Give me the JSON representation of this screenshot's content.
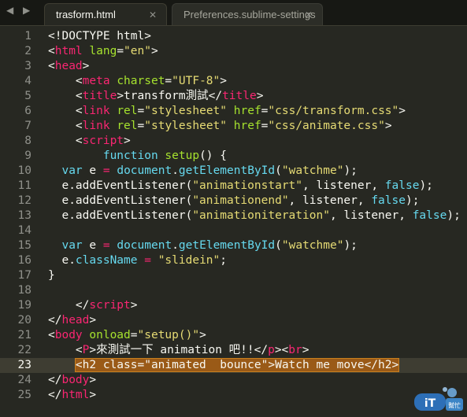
{
  "tabs": [
    {
      "label": "trasform.html",
      "active": true
    },
    {
      "label": "Preferences.sublime-settings",
      "active": false
    }
  ],
  "current_line": 23,
  "lines": [
    {
      "n": "1",
      "code": [
        [
          "p",
          "<!DOCTYPE html>"
        ]
      ]
    },
    {
      "n": "2",
      "code": [
        [
          "p",
          "<"
        ],
        [
          "t",
          "html"
        ],
        [
          "p",
          " "
        ],
        [
          "a",
          "lang"
        ],
        [
          "p",
          "="
        ],
        [
          "s",
          "\"en\""
        ],
        [
          "p",
          ">"
        ]
      ]
    },
    {
      "n": "3",
      "code": [
        [
          "p",
          "<"
        ],
        [
          "t",
          "head"
        ],
        [
          "p",
          ">"
        ]
      ]
    },
    {
      "n": "4",
      "code": [
        [
          "p",
          "    <"
        ],
        [
          "t",
          "meta"
        ],
        [
          "p",
          " "
        ],
        [
          "a",
          "charset"
        ],
        [
          "p",
          "="
        ],
        [
          "s",
          "\"UTF-8\""
        ],
        [
          "p",
          ">"
        ]
      ]
    },
    {
      "n": "5",
      "code": [
        [
          "p",
          "    <"
        ],
        [
          "t",
          "title"
        ],
        [
          "p",
          ">transform測試</"
        ],
        [
          "t",
          "title"
        ],
        [
          "p",
          ">"
        ]
      ]
    },
    {
      "n": "6",
      "code": [
        [
          "p",
          "    <"
        ],
        [
          "t",
          "link"
        ],
        [
          "p",
          " "
        ],
        [
          "a",
          "rel"
        ],
        [
          "p",
          "="
        ],
        [
          "s",
          "\"stylesheet\""
        ],
        [
          "p",
          " "
        ],
        [
          "a",
          "href"
        ],
        [
          "p",
          "="
        ],
        [
          "s",
          "\"css/transform.css\""
        ],
        [
          "p",
          ">"
        ]
      ]
    },
    {
      "n": "7",
      "code": [
        [
          "p",
          "    <"
        ],
        [
          "t",
          "link"
        ],
        [
          "p",
          " "
        ],
        [
          "a",
          "rel"
        ],
        [
          "p",
          "="
        ],
        [
          "s",
          "\"stylesheet\""
        ],
        [
          "p",
          " "
        ],
        [
          "a",
          "href"
        ],
        [
          "p",
          "="
        ],
        [
          "s",
          "\"css/animate.css\""
        ],
        [
          "p",
          ">"
        ]
      ]
    },
    {
      "n": "8",
      "code": [
        [
          "p",
          "    <"
        ],
        [
          "t",
          "script"
        ],
        [
          "p",
          ">"
        ]
      ]
    },
    {
      "n": "9",
      "code": [
        [
          "p",
          "        "
        ],
        [
          "k",
          "function"
        ],
        [
          "p",
          " "
        ],
        [
          "a",
          "setup"
        ],
        [
          "p",
          "() {"
        ]
      ]
    },
    {
      "n": "10",
      "code": [
        [
          "p",
          "  "
        ],
        [
          "k",
          "var"
        ],
        [
          "p",
          " e "
        ],
        [
          "o",
          "="
        ],
        [
          "p",
          " "
        ],
        [
          "k",
          "document"
        ],
        [
          "p",
          "."
        ],
        [
          "k",
          "getElementById"
        ],
        [
          "p",
          "("
        ],
        [
          "s",
          "\"watchme\""
        ],
        [
          "p",
          ");"
        ]
      ]
    },
    {
      "n": "11",
      "code": [
        [
          "p",
          "  e.addEventListener("
        ],
        [
          "s",
          "\"animationstart\""
        ],
        [
          "p",
          ", listener, "
        ],
        [
          "k",
          "false"
        ],
        [
          "p",
          ");"
        ]
      ]
    },
    {
      "n": "12",
      "code": [
        [
          "p",
          "  e.addEventListener("
        ],
        [
          "s",
          "\"animationend\""
        ],
        [
          "p",
          ", listener, "
        ],
        [
          "k",
          "false"
        ],
        [
          "p",
          ");"
        ]
      ]
    },
    {
      "n": "13",
      "code": [
        [
          "p",
          "  e.addEventListener("
        ],
        [
          "s",
          "\"animationiteration\""
        ],
        [
          "p",
          ", listener, "
        ],
        [
          "k",
          "false"
        ],
        [
          "p",
          ");"
        ]
      ]
    },
    {
      "n": "14",
      "code": []
    },
    {
      "n": "15",
      "code": [
        [
          "p",
          "  "
        ],
        [
          "k",
          "var"
        ],
        [
          "p",
          " e "
        ],
        [
          "o",
          "="
        ],
        [
          "p",
          " "
        ],
        [
          "k",
          "document"
        ],
        [
          "p",
          "."
        ],
        [
          "k",
          "getElementById"
        ],
        [
          "p",
          "("
        ],
        [
          "s",
          "\"watchme\""
        ],
        [
          "p",
          ");"
        ]
      ]
    },
    {
      "n": "16",
      "code": [
        [
          "p",
          "  e."
        ],
        [
          "k",
          "className"
        ],
        [
          "p",
          " "
        ],
        [
          "o",
          "="
        ],
        [
          "p",
          " "
        ],
        [
          "s",
          "\"slidein\""
        ],
        [
          "p",
          ";"
        ]
      ]
    },
    {
      "n": "17",
      "code": [
        [
          "p",
          "}"
        ]
      ]
    },
    {
      "n": "18",
      "code": []
    },
    {
      "n": "19",
      "code": [
        [
          "p",
          "    </"
        ],
        [
          "t",
          "script"
        ],
        [
          "p",
          ">"
        ]
      ]
    },
    {
      "n": "20",
      "code": [
        [
          "p",
          "</"
        ],
        [
          "t",
          "head"
        ],
        [
          "p",
          ">"
        ]
      ]
    },
    {
      "n": "21",
      "code": [
        [
          "p",
          "<"
        ],
        [
          "t",
          "body"
        ],
        [
          "p",
          " "
        ],
        [
          "a",
          "onload"
        ],
        [
          "p",
          "="
        ],
        [
          "s",
          "\"setup()\""
        ],
        [
          "p",
          ">"
        ]
      ]
    },
    {
      "n": "22",
      "code": [
        [
          "p",
          "    <"
        ],
        [
          "t",
          "P"
        ],
        [
          "p",
          ">來測試一下 animation 吧!!</"
        ],
        [
          "t",
          "p"
        ],
        [
          "p",
          "><"
        ],
        [
          "t",
          "br"
        ],
        [
          "p",
          ">"
        ]
      ]
    },
    {
      "n": "23",
      "code": [
        [
          "p",
          "    "
        ],
        [
          "sel",
          "<h2 class=\"animated  bounce\">Watch me move</h2>"
        ]
      ]
    },
    {
      "n": "24",
      "code": [
        [
          "p",
          "</"
        ],
        [
          "t",
          "body"
        ],
        [
          "p",
          ">"
        ]
      ]
    },
    {
      "n": "25",
      "code": [
        [
          "p",
          "</"
        ],
        [
          "t",
          "html"
        ],
        [
          "p",
          ">"
        ]
      ]
    }
  ],
  "watermark": {
    "brand": "iT邦幫忙"
  }
}
